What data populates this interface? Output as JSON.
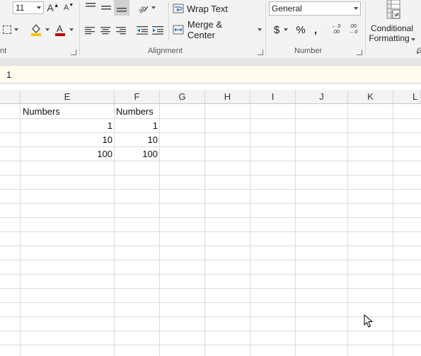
{
  "ribbon": {
    "font_size": "11",
    "icons": {
      "grow_font": "A",
      "shrink_font": "A",
      "orientation": "ab-orientation-icon",
      "fill_color": "#f5c400",
      "font_color": "#c00000"
    },
    "wrap_text": "Wrap Text",
    "merge_center": "Merge & Center",
    "number_format": "General",
    "currency": "$",
    "percent": "%",
    "comma": ",",
    "increase_decimal": "←.0 .00",
    "decrease_decimal": ".00 →.0",
    "conditional_line1": "Conditional",
    "conditional_line2": "Formatting",
    "groups": {
      "font": "nt",
      "alignment": "Alignment",
      "number": "Number",
      "styles": "S"
    }
  },
  "formula_bar": {
    "value": "1"
  },
  "sheet": {
    "columns": [
      "E",
      "F",
      "G",
      "H",
      "I",
      "J",
      "K",
      "L"
    ],
    "cells": {
      "E1": "Numbers",
      "F1": "Numbers",
      "E2": "1",
      "F2": "1",
      "E3": "10",
      "F3": "10",
      "E4": "100",
      "F4": "100"
    }
  }
}
